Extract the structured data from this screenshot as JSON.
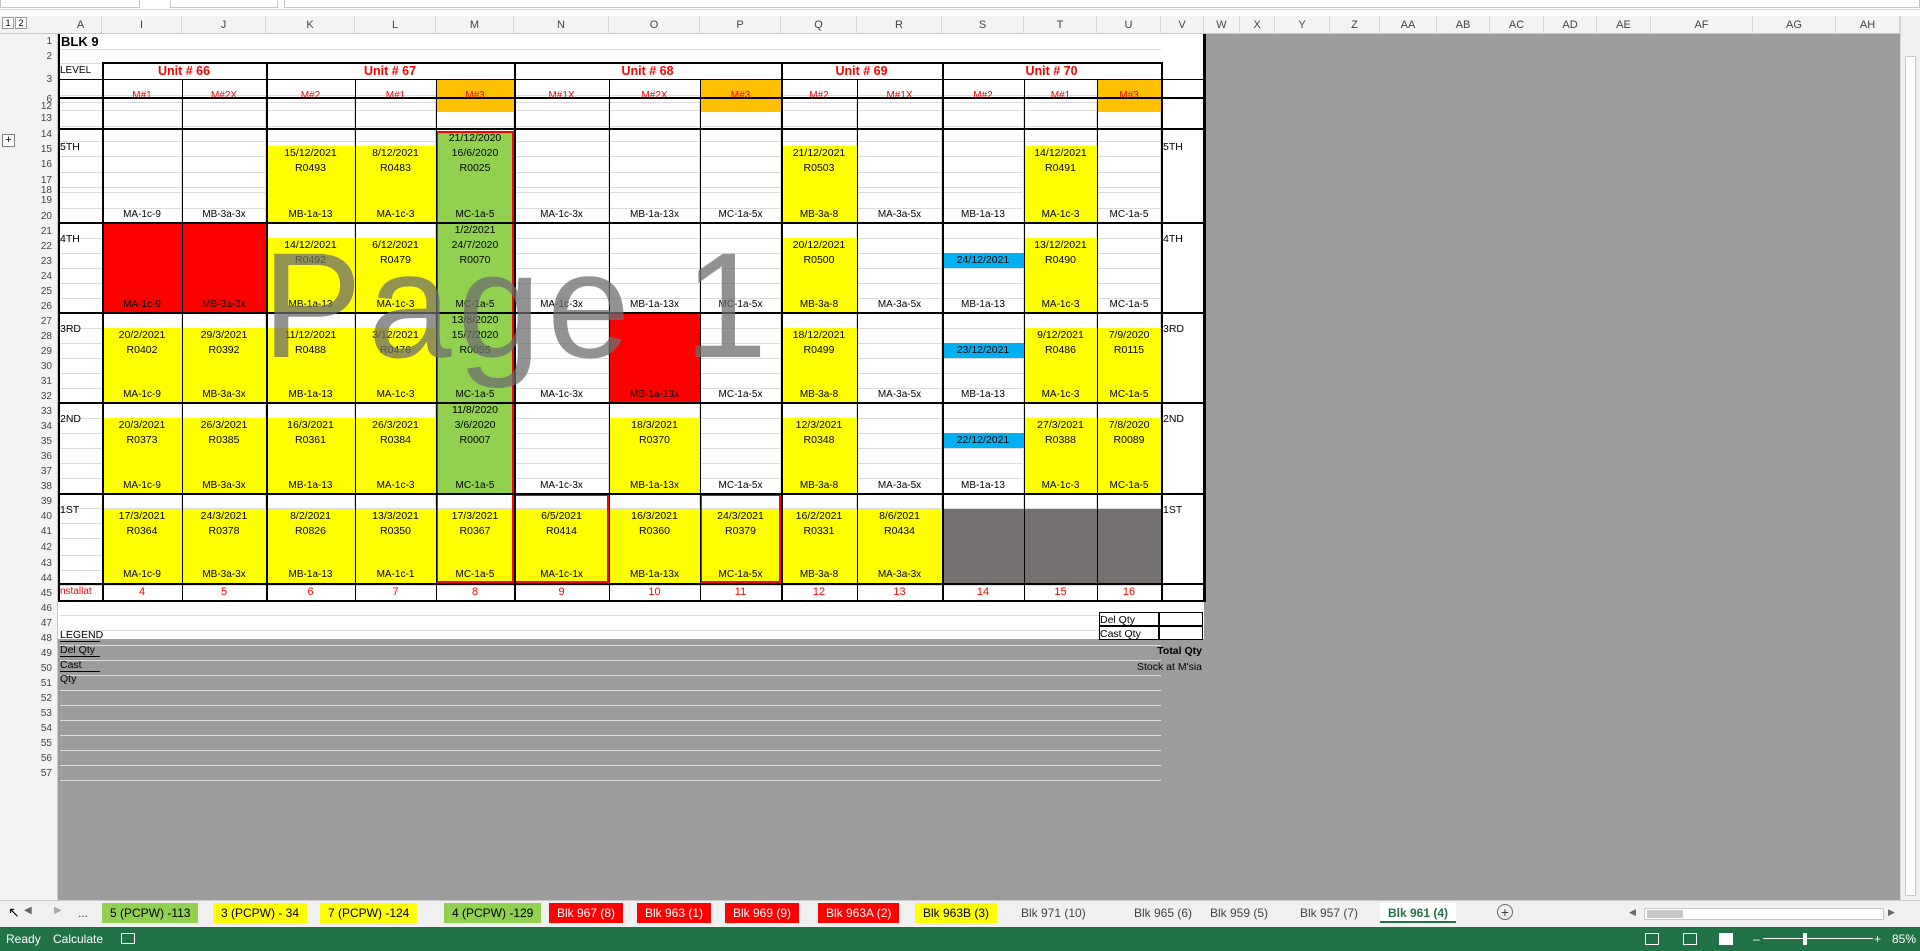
{
  "columns": [
    "A",
    "I",
    "J",
    "K",
    "L",
    "M",
    "N",
    "O",
    "P",
    "Q",
    "R",
    "S",
    "T",
    "U",
    "V",
    "W",
    "X",
    "Y",
    "Z",
    "AA",
    "AB",
    "AC",
    "AD",
    "AE",
    "AF",
    "AG",
    "AH"
  ],
  "rows": [
    "1",
    "2",
    "3",
    "6",
    "12",
    "13",
    "14",
    "15",
    "16",
    "17",
    "18",
    "19",
    "20",
    "21",
    "22",
    "23",
    "24",
    "25",
    "26",
    "27",
    "28",
    "29",
    "30",
    "31",
    "32",
    "33",
    "34",
    "35",
    "36",
    "37",
    "38",
    "39",
    "40",
    "41",
    "42",
    "43",
    "44",
    "45",
    "46",
    "47",
    "48",
    "49",
    "50",
    "51",
    "52",
    "53",
    "54",
    "55",
    "56",
    "57"
  ],
  "title": "BLK 9",
  "level_label": "LEVEL",
  "units": [
    "Unit #  66",
    "Unit #  67",
    "Unit #  68",
    "Unit #  69",
    "Unit #  70"
  ],
  "molds": [
    "M#1",
    "M#2X",
    "M#2",
    "M#1",
    "M#3",
    "M#1X",
    "M#2X",
    "M#3",
    "M#2",
    "M#1X",
    "M#2",
    "M#1",
    "M#3"
  ],
  "levels": [
    "5TH",
    "4TH",
    "3RD",
    "2ND",
    "1ST"
  ],
  "codes": {
    "5TH": [
      "MA-1c-9",
      "MB-3a-3x",
      "MB-1a-13",
      "MA-1c-3",
      "MC-1a-5",
      "MA-1c-3x",
      "MB-1a-13x",
      "MC-1a-5x",
      "MB-3a-8",
      "MA-3a-5x",
      "MB-1a-13",
      "MA-1c-3",
      "MC-1a-5"
    ],
    "4TH": [
      "MA-1c-9",
      "MB-3a-3x",
      "MB-1a-13",
      "MA-1c-3",
      "MC-1a-5",
      "MA-1c-3x",
      "MB-1a-13x",
      "MC-1a-5x",
      "MB-3a-8",
      "MA-3a-5x",
      "MB-1a-13",
      "MA-1c-3",
      "MC-1a-5"
    ],
    "3RD": [
      "MA-1c-9",
      "MB-3a-3x",
      "MB-1a-13",
      "MA-1c-3",
      "MC-1a-5",
      "MA-1c-3x",
      "MB-1a-13x",
      "MC-1a-5x",
      "MB-3a-8",
      "MA-3a-5x",
      "MB-1a-13",
      "MA-1c-3",
      "MC-1a-5"
    ],
    "2ND": [
      "MA-1c-9",
      "MB-3a-3x",
      "MB-1a-13",
      "MA-1c-3",
      "MC-1a-5",
      "MA-1c-3x",
      "MB-1a-13x",
      "MC-1a-5x",
      "MB-3a-8",
      "MA-3a-5x",
      "MB-1a-13",
      "MA-1c-3",
      "MC-1a-5"
    ],
    "1ST": [
      "MA-1c-9",
      "MB-3a-3x",
      "MB-1a-13",
      "MA-1c-1",
      "MC-1a-5",
      "MA-1c-1x",
      "MB-1a-13x",
      "MC-1a-5x",
      "MB-3a-8",
      "MA-3a-3x",
      "",
      "",
      ""
    ]
  },
  "entries": {
    "5TH": [
      [],
      [],
      [
        "15/12/2021",
        "R0493"
      ],
      [
        "8/12/2021",
        "R0483"
      ],
      [
        "21/12/2020",
        "16/6/2020",
        "R0025"
      ],
      [],
      [],
      [],
      [
        "21/12/2021",
        "R0503"
      ],
      [],
      [],
      [
        "14/12/2021",
        "R0491"
      ],
      []
    ],
    "4TH": [
      [],
      [],
      [
        "14/12/2021",
        "R0492"
      ],
      [
        "6/12/2021",
        "R0479"
      ],
      [
        "1/2/2021",
        "24/7/2020",
        "R0070"
      ],
      [],
      [],
      [],
      [
        "20/12/2021",
        "R0500"
      ],
      [],
      [
        "24/12/2021"
      ],
      [
        "13/12/2021",
        "R0490"
      ],
      []
    ],
    "3RD": [
      [
        "20/2/2021",
        "R0402"
      ],
      [
        "29/3/2021",
        "R0392"
      ],
      [
        "11/12/2021",
        "R0488"
      ],
      [
        "3/12/2021",
        "R0476"
      ],
      [
        "13/8/2020",
        "15/7/2020",
        "R0055"
      ],
      [],
      [],
      [],
      [
        "18/12/2021",
        "R0499"
      ],
      [],
      [
        "23/12/2021"
      ],
      [
        "9/12/2021",
        "R0486"
      ],
      [
        "7/9/2020",
        "R0115"
      ]
    ],
    "2ND": [
      [
        "20/3/2021",
        "R0373"
      ],
      [
        "26/3/2021",
        "R0385"
      ],
      [
        "16/3/2021",
        "R0361"
      ],
      [
        "26/3/2021",
        "R0384"
      ],
      [
        "11/8/2020",
        "3/6/2020",
        "R0007"
      ],
      [],
      [
        "18/3/2021",
        "R0370"
      ],
      [],
      [
        "12/3/2021",
        "R0348"
      ],
      [],
      [
        "22/12/2021"
      ],
      [
        "27/3/2021",
        "R0388"
      ],
      [
        "7/8/2020",
        "R0089"
      ]
    ],
    "1ST": [
      [
        "17/3/2021",
        "R0364"
      ],
      [
        "24/3/2021",
        "R0378"
      ],
      [
        "8/2/2021",
        "R0826"
      ],
      [
        "13/3/2021",
        "R0350"
      ],
      [
        "17/3/2021",
        "R0367"
      ],
      [
        "6/5/2021",
        "R0414"
      ],
      [
        "16/3/2021",
        "R0360"
      ],
      [
        "24/3/2021",
        "R0379"
      ],
      [
        "16/2/2021",
        "R0331"
      ],
      [
        "8/6/2021",
        "R0434"
      ],
      [],
      [],
      []
    ]
  },
  "fills": {
    "5TH": [
      "",
      "",
      "y",
      "y",
      "g",
      "",
      "",
      "",
      "y",
      "",
      "",
      "y",
      ""
    ],
    "4TH": [
      "r",
      "r",
      "y",
      "y",
      "g",
      "",
      "",
      "",
      "y",
      "",
      "",
      "y",
      ""
    ],
    "3RD": [
      "y",
      "y",
      "y",
      "y",
      "g",
      "",
      "r",
      "",
      "y",
      "",
      "",
      "y",
      "y"
    ],
    "2ND": [
      "y",
      "y",
      "y",
      "y",
      "g",
      "",
      "y",
      "",
      "y",
      "",
      "",
      "y",
      "y"
    ],
    "1ST": [
      "y",
      "y",
      "y",
      "y",
      "y",
      "y",
      "y",
      "y",
      "y",
      "y",
      "gr",
      "gr",
      "gr"
    ]
  },
  "install_label": "nstallat",
  "install_numbers": [
    "4",
    "5",
    "6",
    "7",
    "8",
    "9",
    "10",
    "11",
    "12",
    "13",
    "14",
    "15",
    "16"
  ],
  "legend": {
    "legend": "LEGEND",
    "del_qty": "Del Qty",
    "cast_qty": "Cast Qty"
  },
  "right_legend": {
    "del_qty": "Del Qty",
    "cast_qty": "Cast Qty",
    "total_qty": "Total Qty",
    "stock": "Stock at M'sia"
  },
  "watermark": "Page 1",
  "sheet_tabs": [
    {
      "label": "...",
      "color": ""
    },
    {
      "label": "5 (PCPW) -113",
      "color": "#92d050"
    },
    {
      "label": "3 (PCPW) - 34",
      "color": "#ffff00"
    },
    {
      "label": "7 (PCPW) -124",
      "color": "#ffff00"
    },
    {
      "label": "4 (PCPW) -129",
      "color": "#92d050"
    },
    {
      "label": "Blk 967 (8)",
      "color": "#ff0000"
    },
    {
      "label": "Blk 963 (1)",
      "color": "#ff0000"
    },
    {
      "label": "Blk 969 (9)",
      "color": "#ff0000"
    },
    {
      "label": "Blk 963A (2)",
      "color": "#ff0000"
    },
    {
      "label": "Blk 963B (3)",
      "color": "#ffff00"
    },
    {
      "label": "Blk 971 (10)",
      "color": ""
    },
    {
      "label": "Blk 965 (6)",
      "color": ""
    },
    {
      "label": "Blk 959 (5)",
      "color": ""
    },
    {
      "label": "Blk 957 (7)",
      "color": ""
    },
    {
      "label": "Blk 961 (4)",
      "color": "active"
    }
  ],
  "status": {
    "ready": "Ready",
    "calculate": "Calculate",
    "zoom": "85%"
  },
  "outline_levels": [
    "1",
    "2"
  ]
}
